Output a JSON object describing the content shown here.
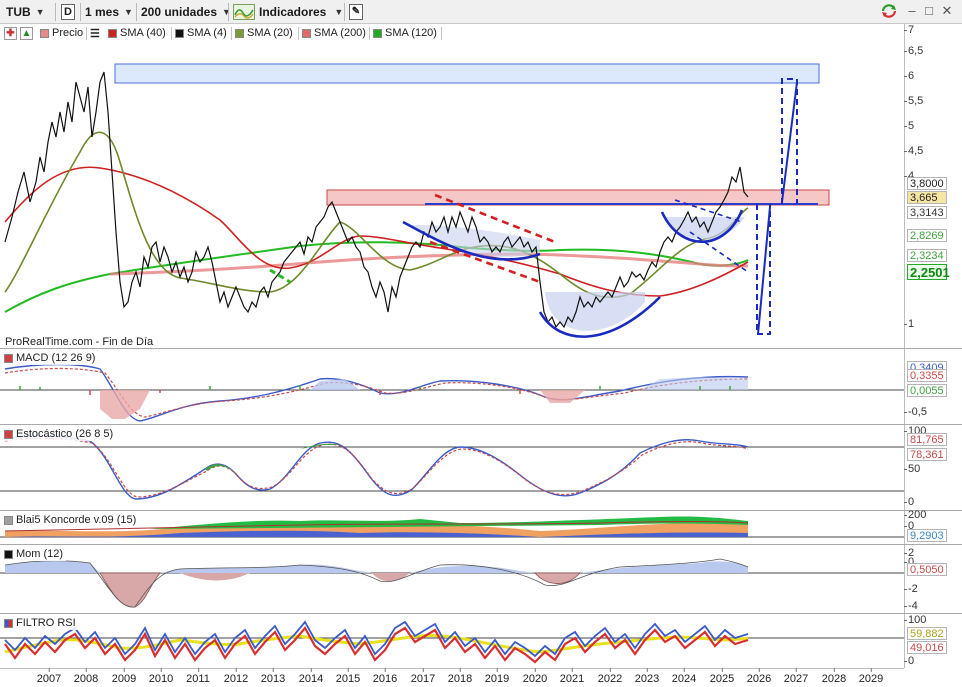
{
  "toolbar": {
    "ticker": "TUB",
    "chart_type_letter": "D",
    "period": "1 mes",
    "units": "200 unidades",
    "indicators_label": "Indicadores",
    "share_icon": "share-icon",
    "window_icons": [
      "minimize-icon",
      "restore-icon",
      "close-icon"
    ]
  },
  "legend": [
    {
      "label": "Precio",
      "color": "#e58a8a"
    },
    {
      "label": "SMA (40)",
      "color": "#cc2222"
    },
    {
      "label": "SMA (4)",
      "color": "#111111"
    },
    {
      "label": "SMA (20)",
      "color": "#7c9a3a"
    },
    {
      "label": "SMA (200)",
      "color": "#e06a6a"
    },
    {
      "label": "SMA (120)",
      "color": "#22aa22"
    }
  ],
  "price_panel": {
    "caption": "ProRealTime.com - Fin de Día",
    "ticks": [
      "7",
      "6,5",
      "6",
      "5,5",
      "5",
      "4,5",
      "4",
      "1"
    ],
    "value_boxes": [
      {
        "label": "3,8000",
        "bg": "#ffffff",
        "fg": "#111111"
      },
      {
        "label": "3,665",
        "bg": "#f6e6a6",
        "fg": "#111111"
      },
      {
        "label": "3,3143",
        "bg": "#ffffff",
        "fg": "#333333"
      },
      {
        "label": "2,8269",
        "bg": "#ffffff",
        "fg": "#3fa43f"
      },
      {
        "label": "2,3234",
        "bg": "#ffffff",
        "fg": "#3fa43f"
      },
      {
        "label": "2,2501",
        "bg": "#eaffea",
        "fg": "#118811"
      }
    ]
  },
  "macd_panel": {
    "title": "MACD (12 26 9)",
    "title_color": "#d04040",
    "ticks": [
      "-0,5"
    ],
    "value_boxes": [
      {
        "label": "0,3409",
        "fg": "#3a5ac8"
      },
      {
        "label": "0,3355",
        "fg": "#c84a4a"
      },
      {
        "label": "0,0055",
        "fg": "#3fa43f"
      }
    ]
  },
  "stoch_panel": {
    "title": "Estocástico (26 8 5)",
    "title_color": "#d04040",
    "ticks": [
      "100",
      "50",
      "0"
    ],
    "value_boxes": [
      {
        "label": "81,765",
        "fg": "#c84a4a"
      },
      {
        "label": "78,361",
        "fg": "#c84a4a"
      }
    ]
  },
  "koncorde_panel": {
    "title": "Blai5 Koncorde v.09 (15)",
    "title_color": "#8a8a8a",
    "ticks": [
      "200",
      "0"
    ],
    "value_boxes": [
      {
        "label": "9,2903",
        "fg": "#3a88c8"
      }
    ]
  },
  "mom_panel": {
    "title": "Mom (12)",
    "title_color": "#222222",
    "ticks": [
      "2",
      "0",
      "-2",
      "-4"
    ],
    "value_boxes": [
      {
        "label": "0,5050",
        "fg": "#c84a4a"
      }
    ]
  },
  "rsi_panel": {
    "title": "FILTRO RSI",
    "title_color": "#3a5ac8",
    "ticks": [
      "100",
      "0"
    ],
    "value_boxes": [
      {
        "label": "59,882",
        "fg": "#b0a020"
      },
      {
        "label": "49,016",
        "fg": "#c84a4a"
      }
    ]
  },
  "x_axis": {
    "years": [
      "2007",
      "2008",
      "2009",
      "2010",
      "2011",
      "2012",
      "2013",
      "2014",
      "2015",
      "2016",
      "2017",
      "2018",
      "2019",
      "2020",
      "2021",
      "2022",
      "2023",
      "2024",
      "2025",
      "2026",
      "2027",
      "2028",
      "2029"
    ]
  }
}
